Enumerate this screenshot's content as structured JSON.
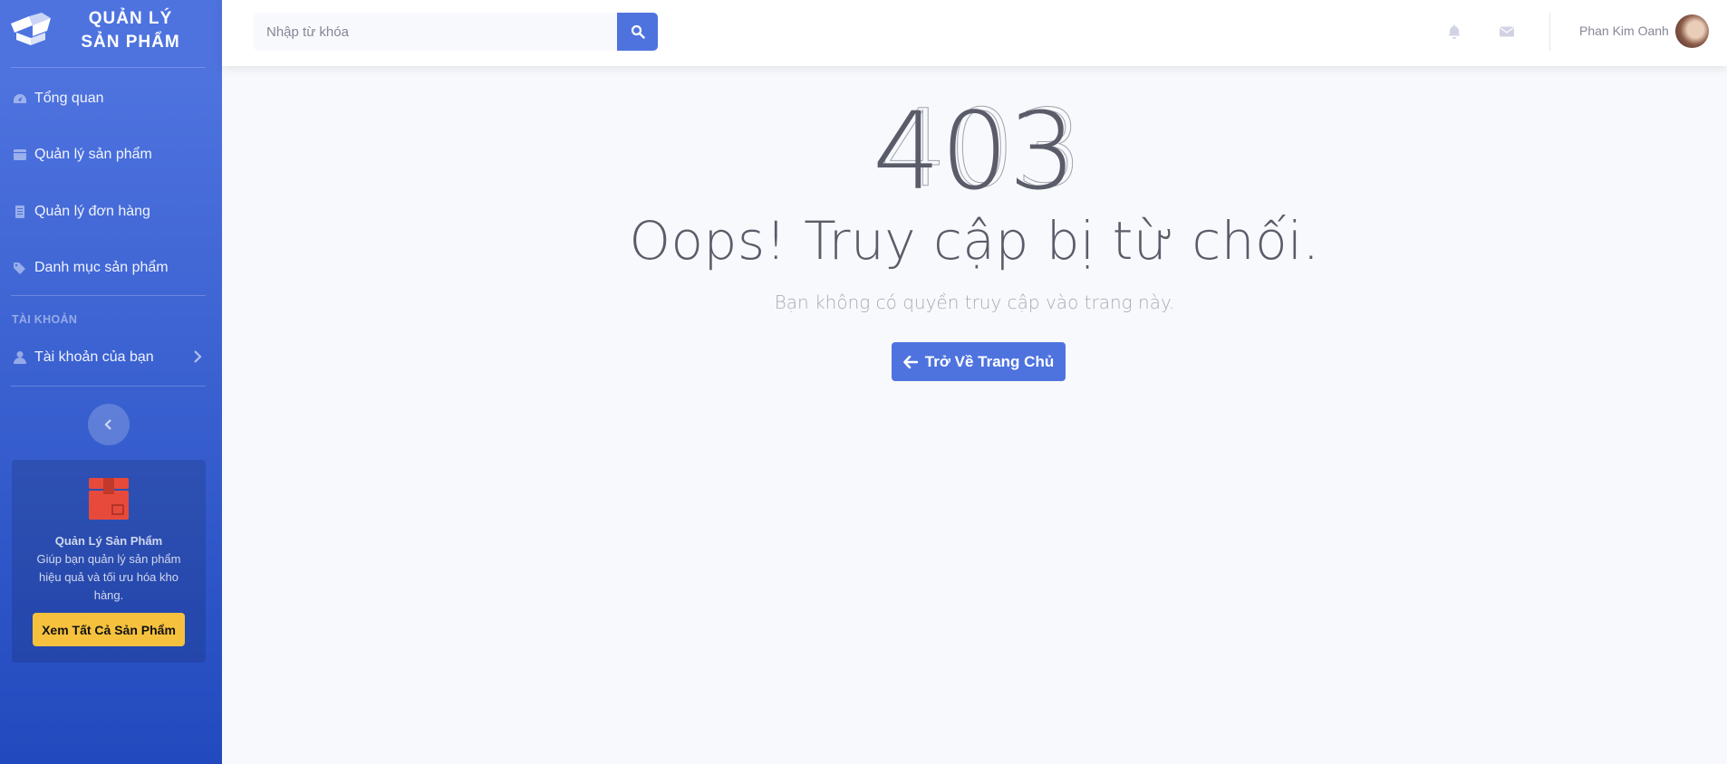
{
  "brand": {
    "line1": "QUẢN LÝ",
    "line2": "SẢN PHẨM"
  },
  "sidebar": {
    "items": [
      {
        "label": "Tổng quan",
        "icon": "tachometer-icon"
      },
      {
        "label": "Quản lý sản phẩm",
        "icon": "box-icon"
      },
      {
        "label": "Quản lý đơn hàng",
        "icon": "document-icon"
      },
      {
        "label": "Danh mục sản phẩm",
        "icon": "tags-icon"
      }
    ],
    "account_heading": "TÀI KHOẢN",
    "account_item": {
      "label": "Tài khoản của bạn",
      "icon": "user-icon"
    },
    "toggle_icon": "chevron-left-icon"
  },
  "promo": {
    "icon": "box-gift-icon",
    "title": "Quản Lý Sản Phẩm",
    "description": "Giúp bạn quản lý sản phẩm hiệu quả và tối ưu hóa kho hàng.",
    "button_label": "Xem Tất Cả Sản Phẩm",
    "icon_color": "#e74a3b",
    "button_color": "#f6c23e"
  },
  "topbar": {
    "search_placeholder": "Nhập từ khóa",
    "user_name": "Phan Kim Oanh",
    "icons": [
      "bell-icon",
      "envelope-icon",
      "search-icon"
    ]
  },
  "error": {
    "code": "403",
    "title": "Oops! Truy cập bị từ chối.",
    "message": "Bạn không có quyền truy cập vào trang này.",
    "button_label": "Trở Về Trang Chủ"
  },
  "colors": {
    "primary": "#4e73df",
    "sidebar_dark": "#224abe",
    "text_dark": "#5a5c69",
    "warning": "#f6c23e"
  }
}
